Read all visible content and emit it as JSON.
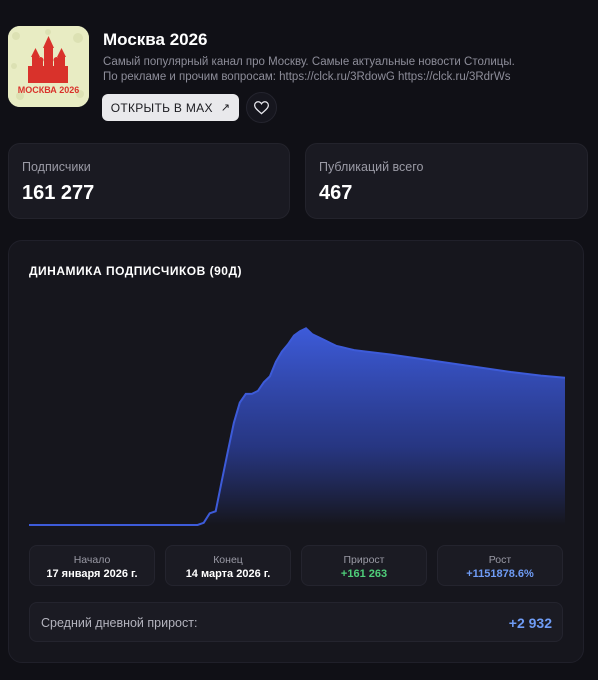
{
  "channel": {
    "title": "Москва 2026",
    "description": "Самый популярный канал про Москву. Самые актуальные новости Столицы. По рекламе и прочим вопросам: https://clck.ru/3RdowG https://clck.ru/3RdrWs",
    "logo_text": "МОСКВА 2026",
    "open_button": "ОТКРЫТЬ В MAX",
    "open_icon": "arrow-up-right-icon",
    "favorite_icon": "heart-icon"
  },
  "stats": {
    "subscribers_label": "Подписчики",
    "subscribers_value": "161 277",
    "posts_label": "Публикаций всего",
    "posts_value": "467"
  },
  "chart_title": "ДИНАМИКА ПОДПИСЧИКОВ (90Д)",
  "chart_data": {
    "type": "area",
    "title": "",
    "xlabel": "",
    "ylabel": "",
    "grid": false,
    "x": [
      0,
      5,
      10,
      15,
      20,
      25,
      28,
      29,
      30,
      31,
      32,
      33,
      34,
      35,
      36,
      37,
      38,
      39,
      40,
      41,
      42,
      43,
      44,
      45,
      46,
      47,
      48,
      49,
      50,
      51,
      52,
      53,
      54,
      55,
      56,
      60,
      65,
      70,
      75,
      80,
      85,
      89
    ],
    "values": [
      14,
      14,
      14,
      14,
      14,
      14,
      14,
      1500,
      8000,
      9500,
      30000,
      50000,
      70000,
      84000,
      90000,
      90000,
      92000,
      98000,
      102000,
      112000,
      119000,
      124000,
      130000,
      133000,
      135000,
      131000,
      129000,
      127000,
      125000,
      123000,
      122000,
      121000,
      120000,
      119500,
      119000,
      117000,
      114000,
      111000,
      108000,
      105000,
      102500,
      101000
    ],
    "ylim": [
      0,
      140000
    ],
    "color": "#3d5bd9"
  },
  "metrics": {
    "start_label": "Начало",
    "start_value": "17 января 2026 г.",
    "end_label": "Конец",
    "end_value": "14 марта 2026 г.",
    "growth_label": "Прирост",
    "growth_value": "+161 263",
    "growth_color": "#4fcf7a",
    "rate_label": "Рост",
    "rate_value": "+1151878.6%",
    "rate_color": "#6f9cf5"
  },
  "avg": {
    "label": "Средний дневной прирост:",
    "value": "+2 932"
  }
}
